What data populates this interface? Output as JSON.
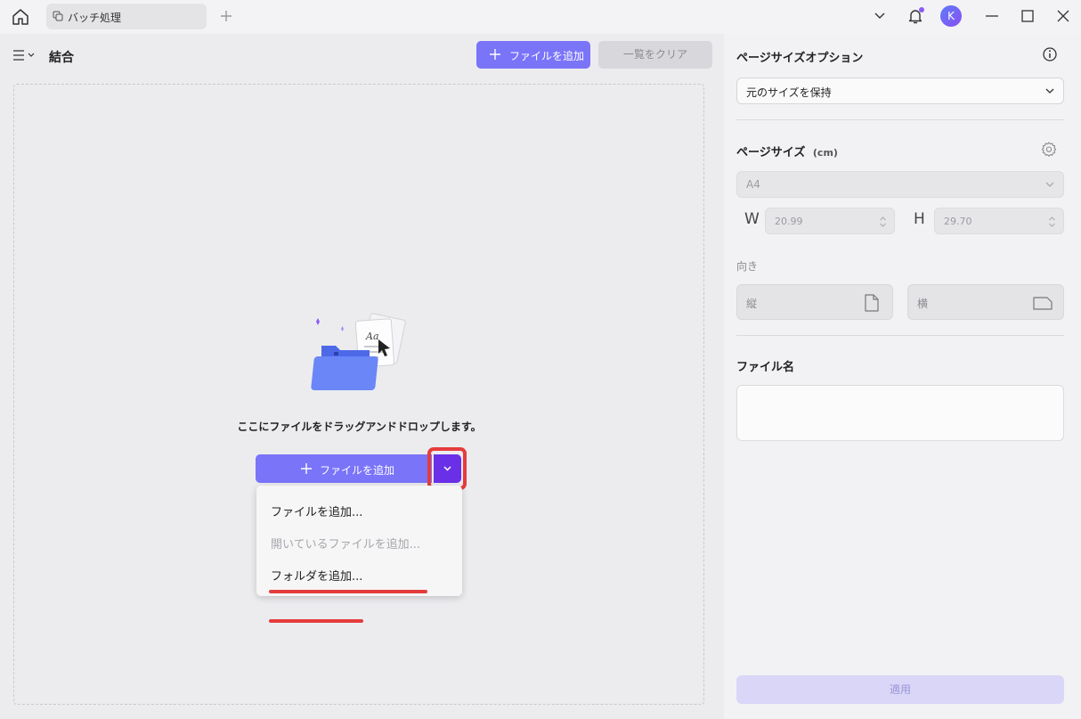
{
  "titlebar": {
    "tab_label": "バッチ処理",
    "avatar_letter": "K"
  },
  "left": {
    "title": "結合",
    "add_file_top": "ファイルを追加",
    "clear_list": "一覧をクリア",
    "drop_text": "ここにファイルをドラッグアンドドロップします。",
    "add_file_main": "ファイルを追加",
    "dropdown": {
      "items": [
        {
          "label": "ファイルを追加..."
        },
        {
          "label": "開いているファイルを追加..."
        },
        {
          "label": "フォルダを追加..."
        }
      ]
    }
  },
  "right": {
    "page_size_option_heading": "ページサイズオプション",
    "page_size_option_value": "元のサイズを保持",
    "page_size_heading": "ページサイズ",
    "page_size_unit": "(cm)",
    "paper_value": "A4",
    "w_label": "W",
    "w_value": "20.99",
    "h_label": "H",
    "h_value": "29.70",
    "orientation_label": "向き",
    "portrait": "縦",
    "landscape": "横",
    "file_name_heading": "ファイル名",
    "file_name_value": "",
    "apply": "適用"
  },
  "colors": {
    "accent": "#7a74f9",
    "accent_dark": "#6a30e8",
    "highlight": "#e53c3c"
  }
}
